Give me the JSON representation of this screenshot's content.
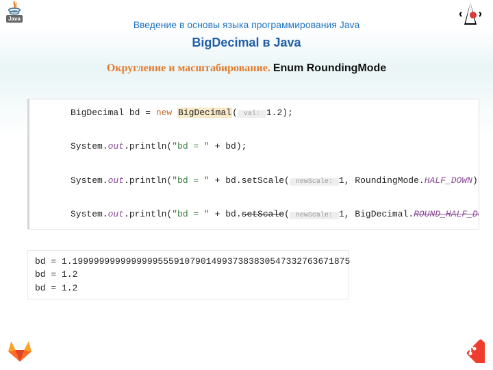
{
  "header": {
    "subtitle": "Введение в основы языка программирования Java",
    "title": "BigDecimal в Java",
    "subheading_orange": "Округление и масштабирование. ",
    "subheading_bold": "Enum RoundingMode"
  },
  "code": {
    "l1_a": "BigDecimal bd = ",
    "l1_new": "new ",
    "l1_cls": "BigDecimal",
    "l1_b": "(",
    "l1_hint": " val: ",
    "l1_c": "1.2);",
    "l2_a": "System.",
    "l2_out": "out",
    "l2_b": ".println(",
    "l2_str": "\"bd = \"",
    "l2_c": " + bd);",
    "l3_a": "System.",
    "l3_out": "out",
    "l3_b": ".println(",
    "l3_str": "\"bd = \"",
    "l3_c": " + bd.setScale(",
    "l3_hint": " newScale: ",
    "l3_d": "1, RoundingMode.",
    "l3_fld": "HALF_DOWN",
    "l3_e": "));",
    "l4_a": "System.",
    "l4_out": "out",
    "l4_b": ".println(",
    "l4_str": "\"bd = \"",
    "l4_c": " + bd.",
    "l4_strike": "setScale",
    "l4_d": "(",
    "l4_hint": " newScale: ",
    "l4_e": "1, BigDecimal.",
    "l4_fld": "ROUND_HALF_DOWN",
    "l4_f": "));"
  },
  "output": {
    "l1": "bd = 1.1999999999999999555910790149937383830547332763671875",
    "l2": "bd = 1.2",
    "l3": "bd = 1.2"
  }
}
